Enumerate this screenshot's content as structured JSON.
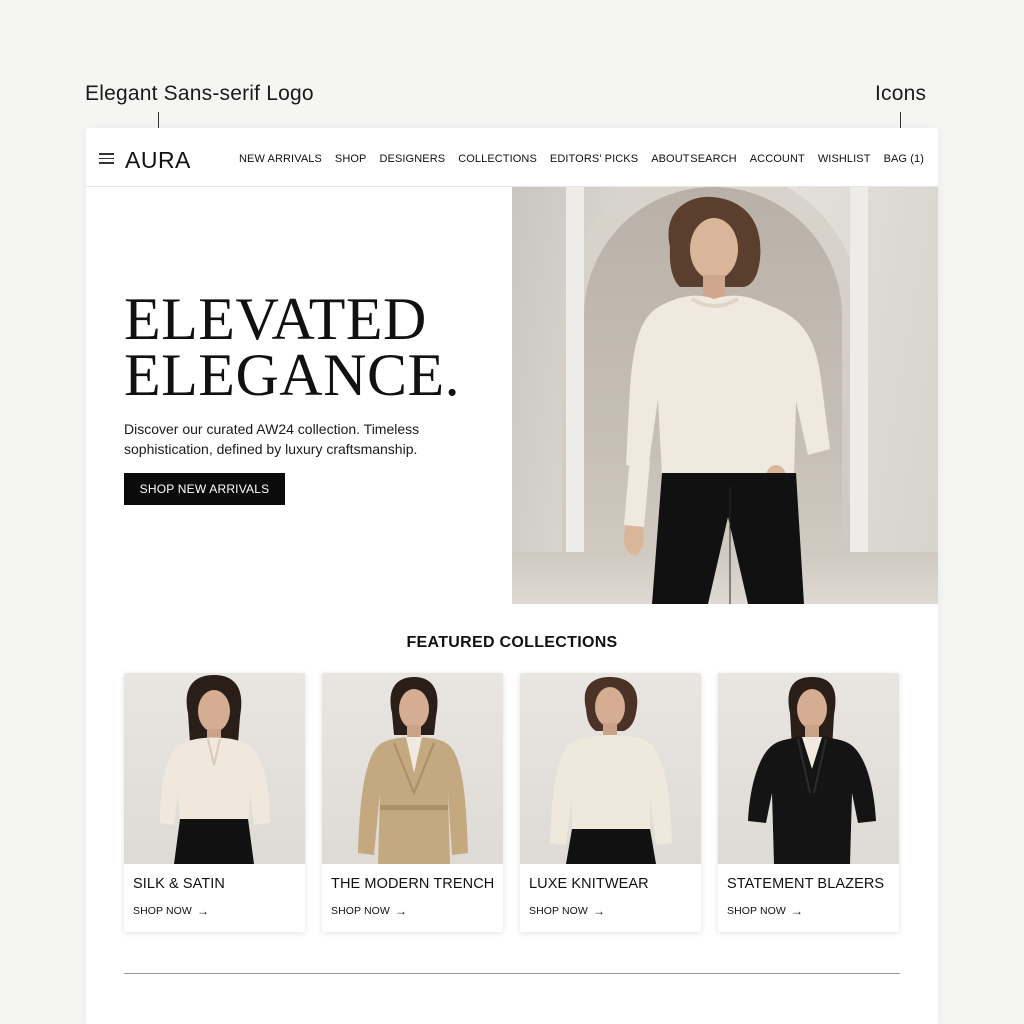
{
  "annotations": {
    "logo_label": "Elegant Sans-serif Logo",
    "icons_label": "Icons"
  },
  "header": {
    "logo": "AURA",
    "nav": [
      "NEW ARRIVALS",
      "SHOP",
      "DESIGNERS",
      "COLLECTIONS",
      "EDITORS' PICKS",
      "ABOUT"
    ],
    "utility": [
      "SEARCH",
      "ACCOUNT",
      "WISHLIST",
      "BAG (1)"
    ]
  },
  "hero": {
    "title_line1": "ELEVATED",
    "title_line2": "ELEGANCE.",
    "subtitle": "Discover our curated AW24 collection. Timeless sophistication, defined by luxury craftsmanship.",
    "cta": "SHOP NEW ARRIVALS"
  },
  "featured": {
    "title": "FEATURED COLLECTIONS",
    "cards": [
      {
        "name": "SILK & SATIN",
        "cta": "SHOP NOW",
        "arrow": "→"
      },
      {
        "name": "THE MODERN TRENCH",
        "cta": "SHOP NOW",
        "arrow": "→"
      },
      {
        "name": "LUXE KNITWEAR",
        "cta": "SHOP NOW",
        "arrow": "→"
      },
      {
        "name": "STATEMENT BLAZERS",
        "cta": "SHOP NOW",
        "arrow": "→"
      }
    ]
  },
  "colors": {
    "accent": "#0b0b0b",
    "background": "#f5f5f4",
    "surface": "#ffffff"
  }
}
